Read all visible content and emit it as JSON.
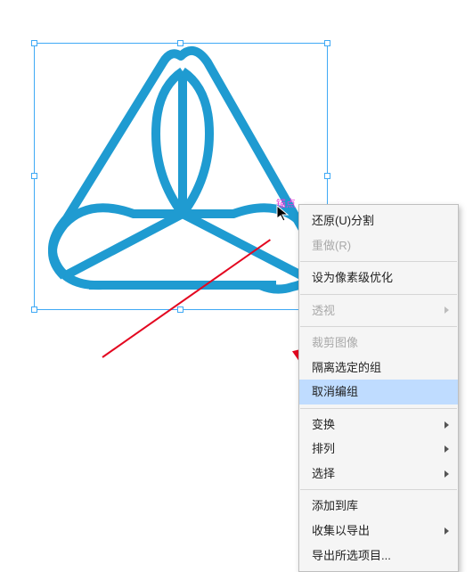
{
  "canvas": {
    "anchor_label": "锚点"
  },
  "menu": {
    "undo": "还原(U)分割",
    "redo": "重做(R)",
    "pixel_optimize": "设为像素级优化",
    "perspective": "透视",
    "crop_image": "裁剪图像",
    "isolate_group": "隔离选定的组",
    "ungroup": "取消编组",
    "transform": "变换",
    "arrange": "排列",
    "select": "选择",
    "add_to_library": "添加到库",
    "collect_export": "收集以导出",
    "export_selection": "导出所选项目..."
  },
  "watermark": ""
}
